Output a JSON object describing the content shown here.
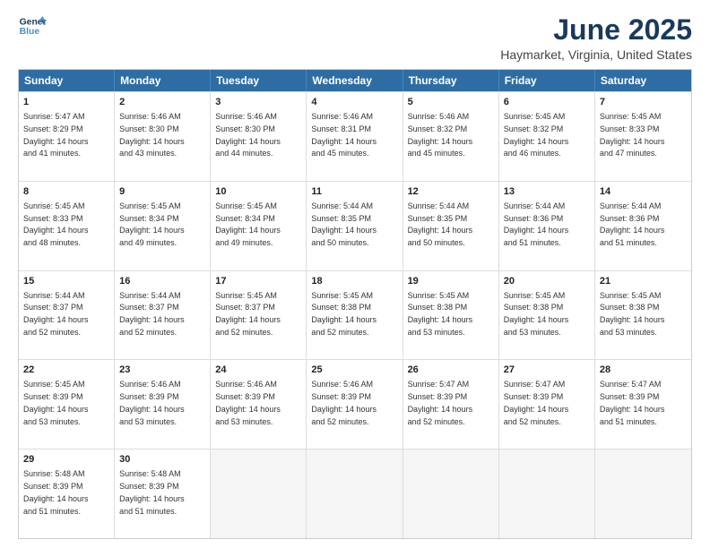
{
  "logo": {
    "line1": "General",
    "line2": "Blue"
  },
  "title": "June 2025",
  "subtitle": "Haymarket, Virginia, United States",
  "header_days": [
    "Sunday",
    "Monday",
    "Tuesday",
    "Wednesday",
    "Thursday",
    "Friday",
    "Saturday"
  ],
  "rows": [
    [
      {
        "day": "1",
        "text": "Sunrise: 5:47 AM\nSunset: 8:29 PM\nDaylight: 14 hours\nand 41 minutes."
      },
      {
        "day": "2",
        "text": "Sunrise: 5:46 AM\nSunset: 8:30 PM\nDaylight: 14 hours\nand 43 minutes."
      },
      {
        "day": "3",
        "text": "Sunrise: 5:46 AM\nSunset: 8:30 PM\nDaylight: 14 hours\nand 44 minutes."
      },
      {
        "day": "4",
        "text": "Sunrise: 5:46 AM\nSunset: 8:31 PM\nDaylight: 14 hours\nand 45 minutes."
      },
      {
        "day": "5",
        "text": "Sunrise: 5:46 AM\nSunset: 8:32 PM\nDaylight: 14 hours\nand 45 minutes."
      },
      {
        "day": "6",
        "text": "Sunrise: 5:45 AM\nSunset: 8:32 PM\nDaylight: 14 hours\nand 46 minutes."
      },
      {
        "day": "7",
        "text": "Sunrise: 5:45 AM\nSunset: 8:33 PM\nDaylight: 14 hours\nand 47 minutes."
      }
    ],
    [
      {
        "day": "8",
        "text": "Sunrise: 5:45 AM\nSunset: 8:33 PM\nDaylight: 14 hours\nand 48 minutes."
      },
      {
        "day": "9",
        "text": "Sunrise: 5:45 AM\nSunset: 8:34 PM\nDaylight: 14 hours\nand 49 minutes."
      },
      {
        "day": "10",
        "text": "Sunrise: 5:45 AM\nSunset: 8:34 PM\nDaylight: 14 hours\nand 49 minutes."
      },
      {
        "day": "11",
        "text": "Sunrise: 5:44 AM\nSunset: 8:35 PM\nDaylight: 14 hours\nand 50 minutes."
      },
      {
        "day": "12",
        "text": "Sunrise: 5:44 AM\nSunset: 8:35 PM\nDaylight: 14 hours\nand 50 minutes."
      },
      {
        "day": "13",
        "text": "Sunrise: 5:44 AM\nSunset: 8:36 PM\nDaylight: 14 hours\nand 51 minutes."
      },
      {
        "day": "14",
        "text": "Sunrise: 5:44 AM\nSunset: 8:36 PM\nDaylight: 14 hours\nand 51 minutes."
      }
    ],
    [
      {
        "day": "15",
        "text": "Sunrise: 5:44 AM\nSunset: 8:37 PM\nDaylight: 14 hours\nand 52 minutes."
      },
      {
        "day": "16",
        "text": "Sunrise: 5:44 AM\nSunset: 8:37 PM\nDaylight: 14 hours\nand 52 minutes."
      },
      {
        "day": "17",
        "text": "Sunrise: 5:45 AM\nSunset: 8:37 PM\nDaylight: 14 hours\nand 52 minutes."
      },
      {
        "day": "18",
        "text": "Sunrise: 5:45 AM\nSunset: 8:38 PM\nDaylight: 14 hours\nand 52 minutes."
      },
      {
        "day": "19",
        "text": "Sunrise: 5:45 AM\nSunset: 8:38 PM\nDaylight: 14 hours\nand 53 minutes."
      },
      {
        "day": "20",
        "text": "Sunrise: 5:45 AM\nSunset: 8:38 PM\nDaylight: 14 hours\nand 53 minutes."
      },
      {
        "day": "21",
        "text": "Sunrise: 5:45 AM\nSunset: 8:38 PM\nDaylight: 14 hours\nand 53 minutes."
      }
    ],
    [
      {
        "day": "22",
        "text": "Sunrise: 5:45 AM\nSunset: 8:39 PM\nDaylight: 14 hours\nand 53 minutes."
      },
      {
        "day": "23",
        "text": "Sunrise: 5:46 AM\nSunset: 8:39 PM\nDaylight: 14 hours\nand 53 minutes."
      },
      {
        "day": "24",
        "text": "Sunrise: 5:46 AM\nSunset: 8:39 PM\nDaylight: 14 hours\nand 53 minutes."
      },
      {
        "day": "25",
        "text": "Sunrise: 5:46 AM\nSunset: 8:39 PM\nDaylight: 14 hours\nand 52 minutes."
      },
      {
        "day": "26",
        "text": "Sunrise: 5:47 AM\nSunset: 8:39 PM\nDaylight: 14 hours\nand 52 minutes."
      },
      {
        "day": "27",
        "text": "Sunrise: 5:47 AM\nSunset: 8:39 PM\nDaylight: 14 hours\nand 52 minutes."
      },
      {
        "day": "28",
        "text": "Sunrise: 5:47 AM\nSunset: 8:39 PM\nDaylight: 14 hours\nand 51 minutes."
      }
    ],
    [
      {
        "day": "29",
        "text": "Sunrise: 5:48 AM\nSunset: 8:39 PM\nDaylight: 14 hours\nand 51 minutes."
      },
      {
        "day": "30",
        "text": "Sunrise: 5:48 AM\nSunset: 8:39 PM\nDaylight: 14 hours\nand 51 minutes."
      },
      {
        "day": "",
        "text": ""
      },
      {
        "day": "",
        "text": ""
      },
      {
        "day": "",
        "text": ""
      },
      {
        "day": "",
        "text": ""
      },
      {
        "day": "",
        "text": ""
      }
    ]
  ]
}
